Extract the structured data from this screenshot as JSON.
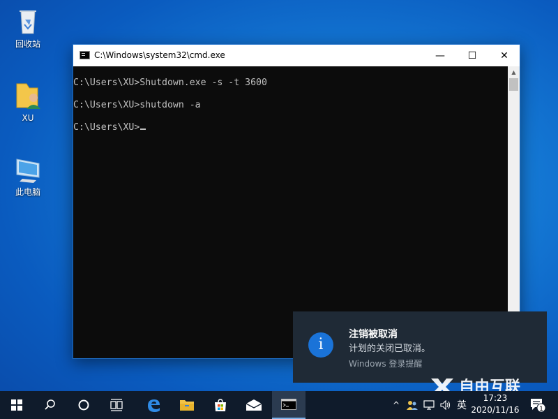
{
  "desktop": {
    "icons": [
      {
        "label": "回收站",
        "icon": "recycle-bin-icon"
      },
      {
        "label": "XU",
        "icon": "user-folder-icon"
      },
      {
        "label": "此电脑",
        "icon": "computer-icon"
      }
    ]
  },
  "window": {
    "title": "C:\\Windows\\system32\\cmd.exe",
    "minimize_glyph": "—",
    "maximize_glyph": "☐",
    "close_glyph": "✕",
    "console_lines": [
      "C:\\Users\\XU>Shutdown.exe -s -t 3600",
      "C:\\Users\\XU>shutdown -a",
      "C:\\Users\\XU>"
    ]
  },
  "notification": {
    "icon_glyph": "i",
    "title": "注销被取消",
    "body": "计划的关闭已取消。",
    "source": "Windows 登录提醒"
  },
  "watermark": {
    "text": "自由互联"
  },
  "taskbar": {
    "buttons": [
      "start-icon",
      "search-icon",
      "cortana-icon",
      "task-view-icon",
      "edge-icon",
      "file-explorer-icon",
      "store-icon",
      "mail-icon",
      "cmd-icon"
    ],
    "tray": {
      "chevron": "^",
      "ime": "英",
      "time": "17:23",
      "date": "2020/11/16",
      "notification_count": "1"
    }
  },
  "colors": {
    "desktop": "#1478d4",
    "taskbar": "#0f1b2b",
    "toast": "#1f2a36",
    "toast_icon": "#1a73d8",
    "console_bg": "#0c0c0c",
    "console_text": "#c0c0c0"
  }
}
